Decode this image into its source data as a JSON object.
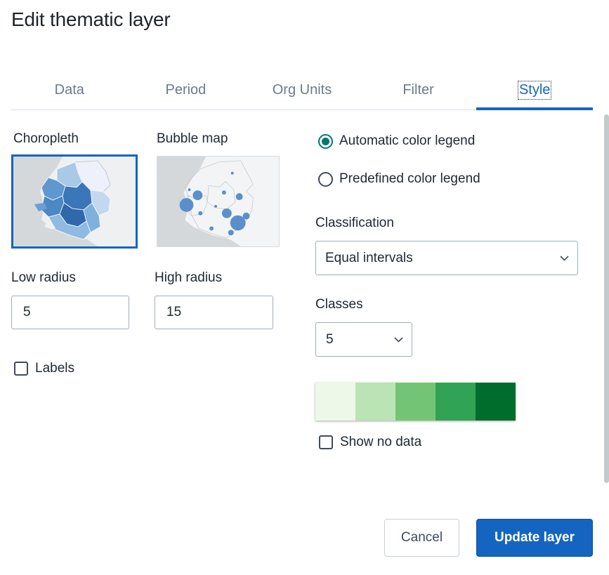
{
  "dialog": {
    "title": "Edit thematic layer"
  },
  "tabs": [
    {
      "label": "Data"
    },
    {
      "label": "Period"
    },
    {
      "label": "Org Units"
    },
    {
      "label": "Filter"
    },
    {
      "label": "Style",
      "active": true
    }
  ],
  "map_type": {
    "choropleth_label": "Choropleth",
    "bubble_label": "Bubble map",
    "selected": "Choropleth"
  },
  "radius": {
    "low_label": "Low radius",
    "low_value": "5",
    "high_label": "High radius",
    "high_value": "15"
  },
  "labels_checkbox": {
    "label": "Labels",
    "checked": false
  },
  "legend": {
    "automatic_label": "Automatic color legend",
    "predefined_label": "Predefined color legend",
    "selected": "automatic"
  },
  "classification": {
    "label": "Classification",
    "value": "Equal intervals"
  },
  "classes": {
    "label": "Classes",
    "value": "5"
  },
  "color_scale": [
    "#edf8e9",
    "#bae4b3",
    "#74c476",
    "#31a354",
    "#006d2c"
  ],
  "show_no_data": {
    "label": "Show no data",
    "checked": false
  },
  "footer": {
    "cancel_label": "Cancel",
    "update_label": "Update layer"
  },
  "colors": {
    "accent": "#1565c0",
    "radio_checked": "#00796b"
  },
  "icons": {
    "select_arrow": "chevron-down-icon"
  }
}
